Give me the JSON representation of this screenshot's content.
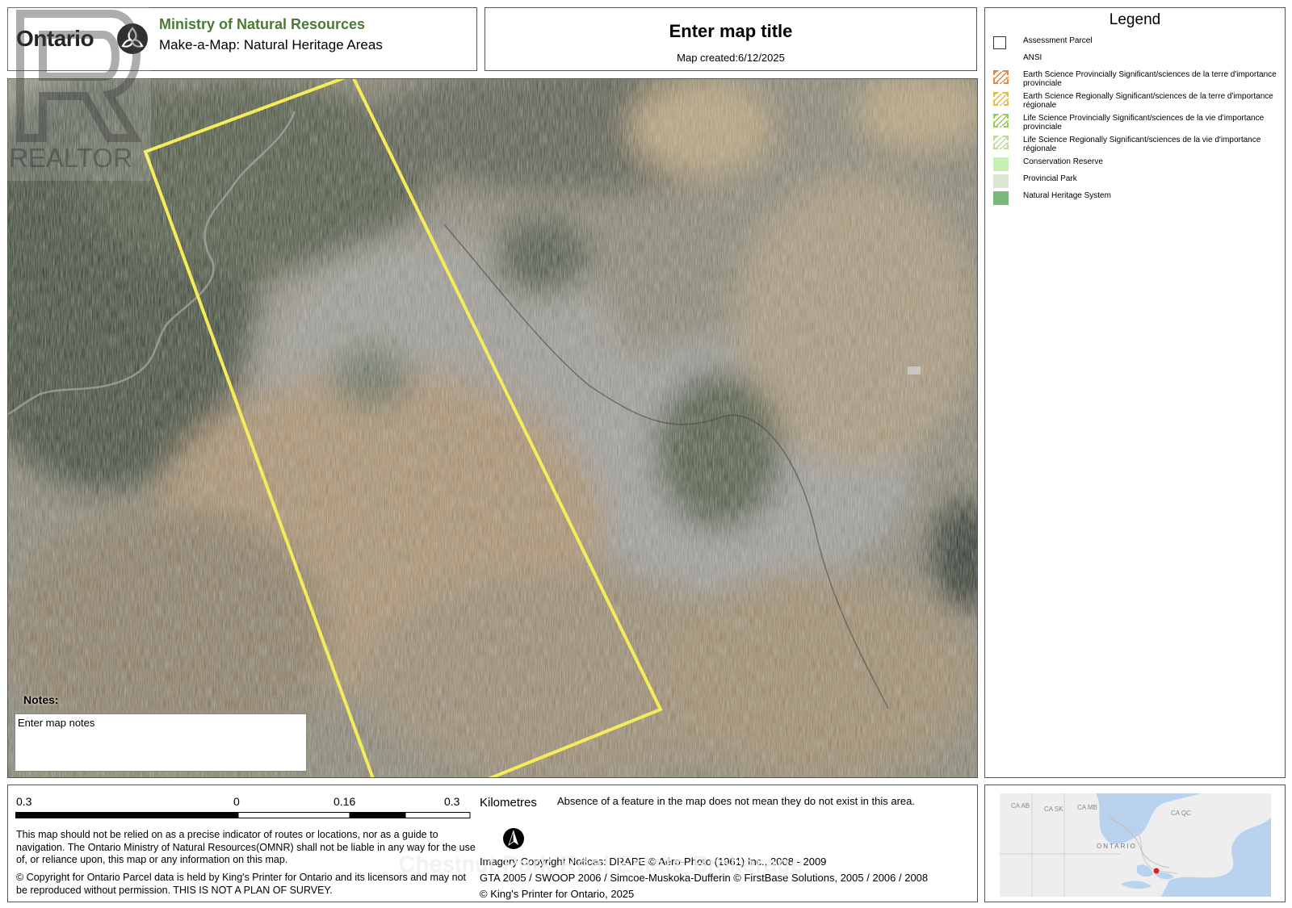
{
  "header": {
    "ontario_word": "Ontario",
    "ministry": "Ministry of Natural Resources",
    "app_name": "Make-a-Map: Natural Heritage Areas",
    "map_title": "Enter map title",
    "map_created": "Map created:6/12/2025"
  },
  "watermark": {
    "realtor_text": "REALTOR",
    "brokerage_text": "Chestnut Park Real Estate Brokerage"
  },
  "legend": {
    "title": "Legend",
    "items": [
      {
        "label": "Assessment Parcel",
        "icon": "parcel-outline",
        "color": "#ffffff"
      },
      {
        "label": "ANSI",
        "icon": "none",
        "color": "#ffffff"
      },
      {
        "label": "Earth Science Provincially Significant/sciences de la terre d'importance provinciale",
        "icon": "hatch-orange",
        "color": "#e07a2a"
      },
      {
        "label": "Earth Science Regionally Significant/sciences de la terre d'importance régionale",
        "icon": "hatch-yellow",
        "color": "#e0b43a"
      },
      {
        "label": "Life Science Provincially Significant/sciences de la vie d'importance provinciale",
        "icon": "hatch-green",
        "color": "#8cc63f"
      },
      {
        "label": "Life Science Regionally Significant/sciences de la vie d'importance régionale",
        "icon": "hatch-lightgreen",
        "color": "#b4d88a"
      },
      {
        "label": "Conservation Reserve",
        "icon": "fill",
        "color": "#c8f0b4"
      },
      {
        "label": "Provincial Park",
        "icon": "fill",
        "color": "#dbe6d4"
      },
      {
        "label": "Natural Heritage System",
        "icon": "fill",
        "color": "#78b878"
      }
    ]
  },
  "map": {
    "parcel_color": "#f5ec5a",
    "notes_label": "Notes:",
    "notes_text": "Enter map notes"
  },
  "scale": {
    "ticks": [
      "0.3",
      "0",
      "0.16",
      "0.3"
    ],
    "unit": "Kilometres"
  },
  "footer": {
    "absence_note": "Absence of a feature in the map does not mean they do not exist in this area.",
    "disclaimer": "This map should not be relied on as a precise indicator of routes or locations, nor as a guide to navigation. The Ontario Ministry of Natural Resources(OMNR) shall not be liable in any way for the use of, or reliance upon, this map or any information on this map.",
    "copyright": "© Copyright for Ontario Parcel data is held by King's Printer for Ontario and its licensors and may not be reproduced without permission. THIS IS NOT A PLAN OF SURVEY.",
    "imagery_line1": "Imagery Copyright Notices: DRAPE © Aéro-Photo (1961) Inc., 2008 - 2009",
    "imagery_line2": "GTA 2005 / SWOOP 2006 / Simcoe-Muskoka-Dufferin © FirstBase Solutions, 2005 / 2006 / 2008",
    "imagery_line3": "© King's Printer for Ontario,  2025"
  },
  "inset": {
    "labels": [
      "CA AB",
      "CA SK",
      "CA MB",
      "CA QC",
      "ONTARIO"
    ],
    "marker_color": "#e02020",
    "water_color": "#b9d3ee",
    "land_color": "#eeeeee"
  }
}
